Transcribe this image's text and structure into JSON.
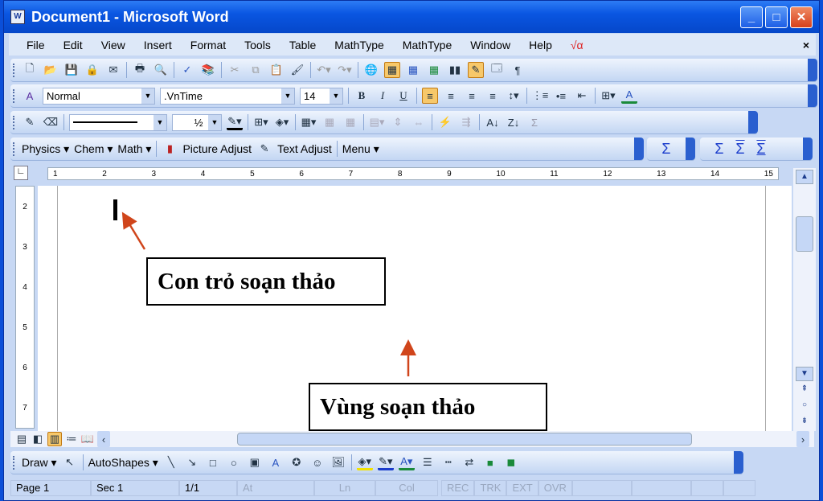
{
  "window": {
    "title": "Document1 - Microsoft Word",
    "app_icon": "W"
  },
  "menu": [
    "File",
    "Edit",
    "View",
    "Insert",
    "Format",
    "Tools",
    "Table",
    "MathType",
    "MathType",
    "Window",
    "Help",
    "√α"
  ],
  "menu_close": "×",
  "formatting": {
    "style": "Normal",
    "font": ".VnTime",
    "size": "14"
  },
  "drawing_line_weight": "½",
  "custom_toolbar": [
    "Physics ▾",
    "Chem ▾",
    "Math ▾",
    "Picture Adjust",
    "Text Adjust",
    "Menu ▾"
  ],
  "sigma": "Σ",
  "ruler_marks": [
    "1",
    "2",
    "3",
    "4",
    "5",
    "6",
    "7",
    "8",
    "9",
    "10",
    "11",
    "12",
    "13",
    "14",
    "15"
  ],
  "vruler_marks": [
    "2",
    "3",
    "4",
    "5",
    "6",
    "7"
  ],
  "draw_toolbar": {
    "draw": "Draw ▾",
    "autoshapes": "AutoShapes ▾"
  },
  "status": {
    "page": "Page  1",
    "sec": "Sec  1",
    "pages": "1/1",
    "at": "At",
    "ln": "Ln",
    "col": "Col",
    "rec": "REC",
    "trk": "TRK",
    "ext": "EXT",
    "ovr": "OVR"
  },
  "annotations": {
    "cursor_label": "Con trỏ soạn thảo",
    "area_label": "Vùng soạn thảo",
    "arrow_color": "#d0451b"
  }
}
